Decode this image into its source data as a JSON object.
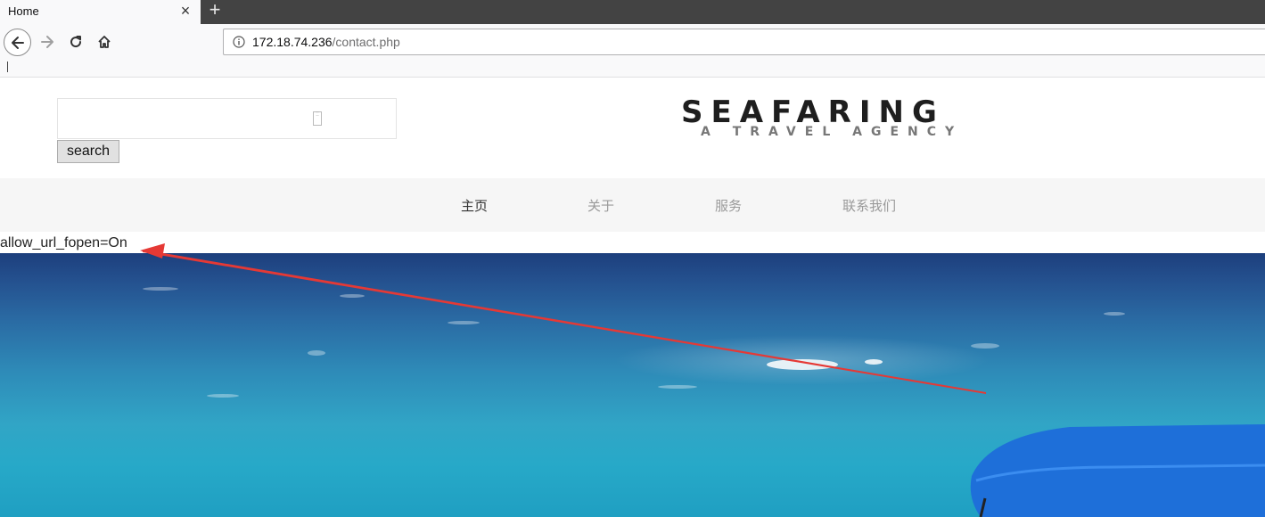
{
  "browser": {
    "tab_title": "Home",
    "tab_close": "×",
    "new_tab": "+",
    "url_host": "172.18.74.236",
    "url_path": "/contact.php"
  },
  "page": {
    "search_button": "search",
    "logo_title": "SEAFARING",
    "logo_subtitle": "A TRAVEL AGENCY",
    "menu": [
      "主页",
      "关于",
      "服务",
      "联系我们"
    ],
    "output_text": "allow_url_fopen=On"
  },
  "colors": {
    "annotation_arrow": "#e53935",
    "sea_top": "#1d3f7d",
    "sea_bottom": "#1f9fc2",
    "boat_canopy": "#1e6fd9"
  }
}
